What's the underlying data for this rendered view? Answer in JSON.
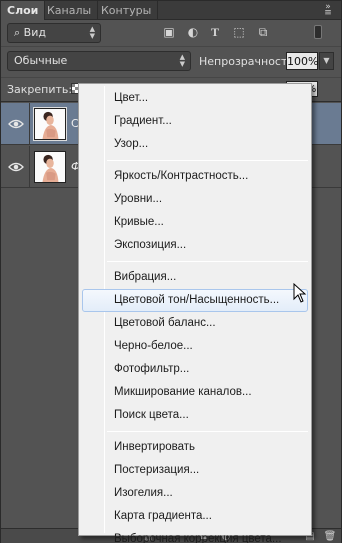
{
  "tabs": [
    {
      "label": "Слои"
    },
    {
      "label": "Каналы"
    },
    {
      "label": "Контуры"
    }
  ],
  "filter": {
    "kind_value": "Вид"
  },
  "blend": {
    "mode_value": "Обычные",
    "opacity_label": "Непрозрачность:",
    "opacity_value": "100%"
  },
  "lock": {
    "label": "Закрепить:",
    "fill_value": "100%"
  },
  "layers": [
    {
      "name": "С",
      "selected": true
    },
    {
      "name": "Ф",
      "selected": false
    }
  ],
  "menu": {
    "group1": [
      "Цвет...",
      "Градиент...",
      "Узор..."
    ],
    "group2": [
      "Яркость/Контрастность...",
      "Уровни...",
      "Кривые...",
      "Экспозиция..."
    ],
    "group3": [
      "Вибрация...",
      "Цветовой тон/Насыщенность...",
      "Цветовой баланс...",
      "Черно-белое...",
      "Фотофильтр...",
      "Микширование каналов...",
      "Поиск цвета..."
    ],
    "group4": [
      "Инвертировать",
      "Постеризация...",
      "Изогелия...",
      "Карта градиента...",
      "Выборочная коррекция цвета..."
    ],
    "highlighted": "Цветовой тон/Насыщенность..."
  },
  "colors": {
    "selected_layer": "#6a7b92",
    "menu_highlight_border": "#a9c6ec"
  }
}
